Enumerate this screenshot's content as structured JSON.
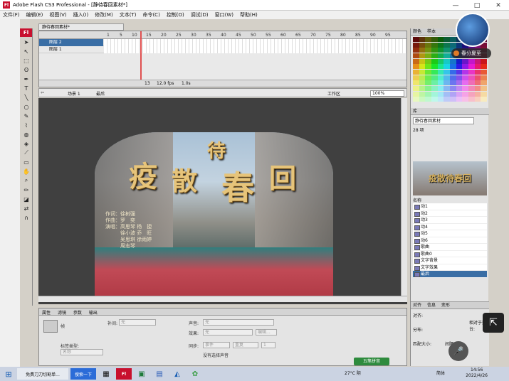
{
  "app": {
    "title": "Adobe Flash CS3 Professional - [静待春回素材*]",
    "logo": "Fl",
    "window_buttons": [
      "—",
      "□",
      "✕"
    ]
  },
  "menu": [
    "文件(F)",
    "编辑(E)",
    "视图(V)",
    "插入(I)",
    "修改(M)",
    "文本(T)",
    "命令(C)",
    "控制(O)",
    "调试(D)",
    "窗口(W)",
    "帮助(H)"
  ],
  "document_tab": "静待春回素材*",
  "timeline": {
    "frame_numbers": [
      "1",
      "5",
      "10",
      "15",
      "20",
      "25",
      "30",
      "35",
      "40",
      "45",
      "50",
      "55",
      "60",
      "65",
      "70",
      "75",
      "80",
      "85",
      "90",
      "95"
    ],
    "layers": [
      {
        "name": "图层 2",
        "selected": true
      },
      {
        "name": "图层 1",
        "selected": false
      }
    ],
    "current_frame": "13",
    "fps": "12.0 fps",
    "time": "1.0s"
  },
  "editbar": {
    "scene": "场景 1",
    "symbol": "最后",
    "workspace": "工作区",
    "zoom": "100%"
  },
  "stage": {
    "title_chars": [
      "疫",
      "散",
      "待",
      "春",
      "回"
    ],
    "credits": [
      "作词：徐树强",
      "作曲：罗　奕",
      "演唱：高思琴 杨　捷",
      "　　　徐小波 乔　旺",
      "　　　吴思琪 徐雨婷",
      "　　　周志琴"
    ]
  },
  "properties": {
    "tabs": [
      "属性",
      "滤镜",
      "参数",
      "输出"
    ],
    "frame_label": "帧",
    "tween_label": "补间:",
    "tween_value": "无",
    "label_type_label": "标签类型:",
    "label_type_value": "名称",
    "sound_label": "声音:",
    "sound_value": "无",
    "effect_label": "效果:",
    "effect_value": "无",
    "edit_button": "编辑...",
    "sync_label": "同步:",
    "sync_value": "事件",
    "repeat_value": "重复",
    "repeat_count": "1",
    "no_sound": "没有选择声音"
  },
  "right_panel": {
    "color_tabs": [
      "颜色",
      "样本"
    ],
    "library_tab": "库",
    "library_doc": "静待春回素材",
    "item_count": "28 项",
    "name_header": "名称",
    "thumb_text": "疫散待春回",
    "items": [
      {
        "name": "动1",
        "selected": false
      },
      {
        "name": "动2",
        "selected": false
      },
      {
        "name": "动3",
        "selected": false
      },
      {
        "name": "动4",
        "selected": false
      },
      {
        "name": "动5",
        "selected": false
      },
      {
        "name": "动6",
        "selected": false
      },
      {
        "name": "歌曲",
        "selected": false
      },
      {
        "name": "歌曲0",
        "selected": false
      },
      {
        "name": "文字背景",
        "selected": false
      },
      {
        "name": "文字效果",
        "selected": false
      },
      {
        "name": "最后",
        "selected": true
      }
    ],
    "align_tabs": [
      "对齐",
      "信息",
      "变形"
    ],
    "align_labels": [
      "对齐:",
      "分布:",
      "匹配大小:",
      "间隔:",
      "相对于舞台:"
    ]
  },
  "overlay": {
    "badge": "春分夏至",
    "green_badge": "五笔拼音"
  },
  "taskbar": {
    "items": [
      "免费刀刀切割单...",
      "搜索一下"
    ],
    "weather": "27°C 阴",
    "ime": "简体",
    "time": "14:56",
    "date": "2022/4/26"
  }
}
